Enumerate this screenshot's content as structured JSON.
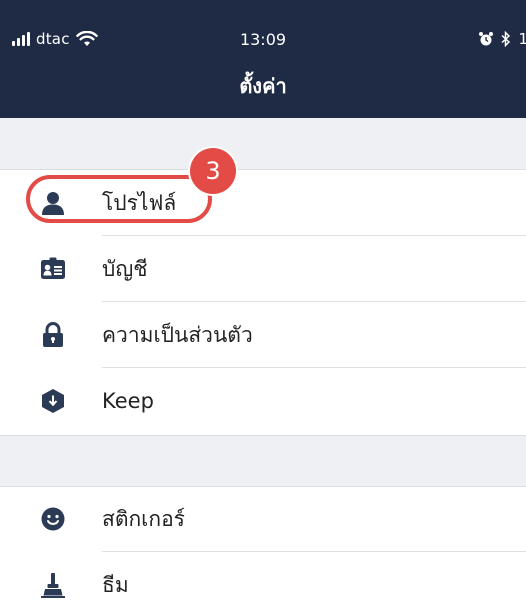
{
  "status_bar": {
    "carrier": "dtac",
    "time": "13:09",
    "right_text": "1"
  },
  "nav": {
    "title": "ตั้งค่า"
  },
  "annotation": {
    "step_number": "3",
    "color": "#e34b47"
  },
  "colors": {
    "header_bg": "#1f2a44",
    "section_bg": "#eff0f3",
    "icon": "#2b3a55"
  },
  "settings": {
    "items": [
      {
        "label": "โปรไฟล์",
        "icon": "person-icon"
      },
      {
        "label": "บัญชี",
        "icon": "id-card-icon"
      },
      {
        "label": "ความเป็นส่วนตัว",
        "icon": "lock-icon"
      },
      {
        "label": "Keep",
        "icon": "keep-download-icon"
      },
      {
        "label": "สติกเกอร์",
        "icon": "smiley-icon"
      },
      {
        "label": "ธีม",
        "icon": "brush-icon"
      }
    ]
  }
}
